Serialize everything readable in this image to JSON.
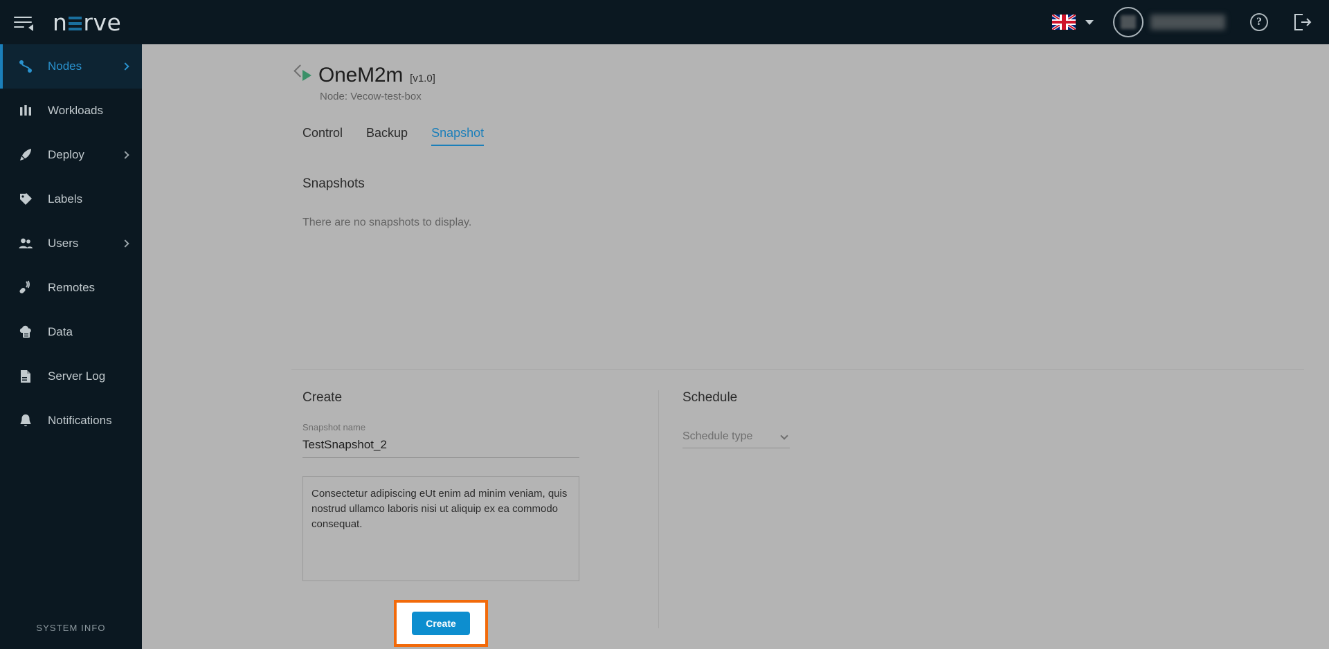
{
  "topbar": {
    "menu_icon": "hamburger-collapse-icon",
    "logo_text_left": "n",
    "logo_text_right": "rve",
    "language_flag": "uk-flag-icon",
    "language_caret": "chevron-down-icon",
    "avatar_icon": "avatar",
    "user_name": "",
    "help_label": "?",
    "logout_icon": "logout-icon"
  },
  "sidebar": {
    "items": [
      {
        "label": "Nodes",
        "icon": "nodes-icon",
        "active": true,
        "has_chevron": true
      },
      {
        "label": "Workloads",
        "icon": "workloads-icon",
        "active": false,
        "has_chevron": false
      },
      {
        "label": "Deploy",
        "icon": "deploy-rocket-icon",
        "active": false,
        "has_chevron": true
      },
      {
        "label": "Labels",
        "icon": "labels-tag-icon",
        "active": false,
        "has_chevron": false
      },
      {
        "label": "Users",
        "icon": "users-icon",
        "active": false,
        "has_chevron": true
      },
      {
        "label": "Remotes",
        "icon": "remotes-icon",
        "active": false,
        "has_chevron": false
      },
      {
        "label": "Data",
        "icon": "data-cloud-icon",
        "active": false,
        "has_chevron": false
      },
      {
        "label": "Server Log",
        "icon": "server-log-icon",
        "active": false,
        "has_chevron": false
      },
      {
        "label": "Notifications",
        "icon": "notifications-bell-icon",
        "active": false,
        "has_chevron": false
      }
    ],
    "footer_label": "SYSTEM INFO"
  },
  "main": {
    "back_icon": "back-chevron-icon",
    "status_icon": "running-play-icon",
    "title": "OneM2m",
    "version": "[v1.0]",
    "node_line": "Node: Vecow-test-box",
    "tabs": [
      {
        "label": "Control",
        "active": false
      },
      {
        "label": "Backup",
        "active": false
      },
      {
        "label": "Snapshot",
        "active": true
      }
    ],
    "snapshots_heading": "Snapshots",
    "empty_message": "There are no snapshots to display."
  },
  "create_panel": {
    "title": "Create",
    "name_label": "Snapshot name",
    "name_value": "TestSnapshot_2",
    "description_value": "Consectetur adipiscing eUt enim ad minim veniam, quis nostrud ullamco laboris nisi ut aliquip ex ea commodo consequat.",
    "description_placeholder": "",
    "button_label": "Create"
  },
  "schedule_panel": {
    "title": "Schedule",
    "select_placeholder": "Schedule type",
    "select_caret": "chevron-down-icon"
  },
  "colors": {
    "accent_blue": "#1b7fba",
    "button_blue": "#0d8ecf",
    "highlight_orange": "#f26a0a",
    "sidebar_bg": "#0b1821",
    "page_bg": "#b4b4b4",
    "status_green": "#3a9068"
  }
}
